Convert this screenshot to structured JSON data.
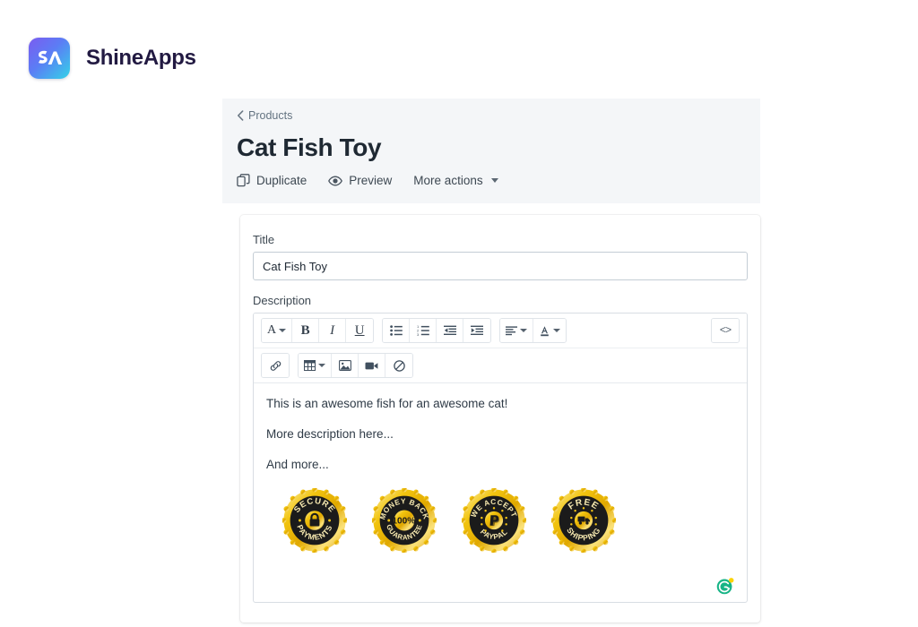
{
  "brand": {
    "name": "ShineApps",
    "logo_text": "SA",
    "gradient_from": "#7b5cf0",
    "gradient_to": "#34d3e8"
  },
  "page": {
    "breadcrumb": "Products",
    "title": "Cat Fish Toy",
    "actions": [
      {
        "label": "Duplicate",
        "icon": "duplicate-icon"
      },
      {
        "label": "Preview",
        "icon": "eye-icon"
      },
      {
        "label": "More actions",
        "icon": "chevron-down-icon"
      }
    ]
  },
  "form": {
    "title_label": "Title",
    "title_value": "Cat Fish Toy",
    "title_placeholder": "Product title",
    "description_label": "Description"
  },
  "editor": {
    "toolbar_row1": [
      {
        "name": "font-style-dropdown",
        "glyph": "A",
        "caret": true
      },
      {
        "name": "bold-button",
        "glyph": "B",
        "caret": false
      },
      {
        "name": "italic-button",
        "glyph": "I",
        "caret": false
      },
      {
        "name": "underline-button",
        "glyph": "U",
        "caret": false
      },
      {
        "name": "unordered-list-button",
        "glyph": "bullet-list-icon",
        "caret": false
      },
      {
        "name": "ordered-list-button",
        "glyph": "numbered-list-icon",
        "caret": false
      },
      {
        "name": "outdent-button",
        "glyph": "outdent-icon",
        "caret": false
      },
      {
        "name": "indent-button",
        "glyph": "indent-icon",
        "caret": false
      },
      {
        "name": "align-dropdown",
        "glyph": "align-left-icon",
        "caret": true
      },
      {
        "name": "text-color-dropdown",
        "glyph": "text-color-icon",
        "caret": true
      }
    ],
    "code_view_label": "<>",
    "toolbar_row2": [
      {
        "name": "insert-link-button",
        "glyph": "link-icon",
        "caret": false
      },
      {
        "name": "insert-table-dropdown",
        "glyph": "table-icon",
        "caret": true
      },
      {
        "name": "insert-image-button",
        "glyph": "image-icon",
        "caret": false
      },
      {
        "name": "insert-video-button",
        "glyph": "video-icon",
        "caret": false
      },
      {
        "name": "clear-formatting-button",
        "glyph": "clear-format-icon",
        "caret": false
      }
    ],
    "paragraphs": [
      "This is an awesome fish for an awesome cat!",
      "More description here...",
      "And more..."
    ],
    "badges": [
      {
        "name": "secure-payments-badge",
        "top_text": "SECURE",
        "bottom_text": "PAYMENTS",
        "center": "lock-icon"
      },
      {
        "name": "money-back-badge",
        "top_text": "MONEY BACK",
        "bottom_text": "GUARANTEE",
        "center": "100%"
      },
      {
        "name": "paypal-badge",
        "top_text": "WE ACCEPT",
        "bottom_text": "PAYPAL",
        "center": "paypal-icon"
      },
      {
        "name": "free-shipping-badge",
        "top_text": "FREE",
        "bottom_text": "SHIPPING",
        "center": "truck-icon"
      }
    ],
    "badge_gold": "#f3c417",
    "badge_dark": "#1b1b1b",
    "grammarly": {
      "name": "grammarly-icon",
      "letter": "G",
      "color": "#17b486",
      "dot_color": "#fbd304"
    }
  }
}
